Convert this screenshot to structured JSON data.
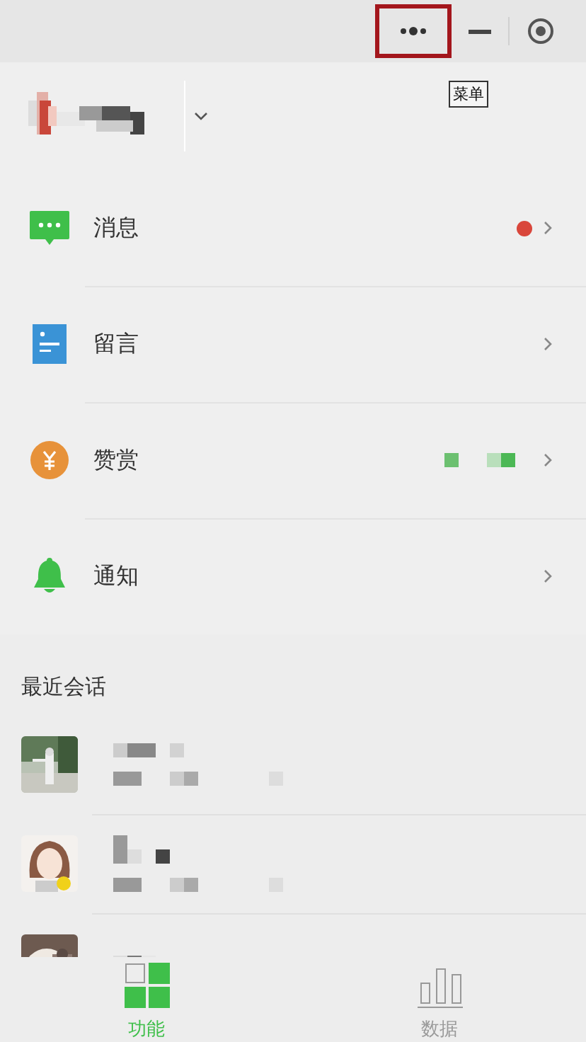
{
  "title_bar": {
    "menu_button": {
      "highlighted": true
    },
    "tooltip": "菜单"
  },
  "menu": [
    {
      "kind": "message",
      "label": "消息",
      "badge": true,
      "blurred_value": false
    },
    {
      "kind": "comment",
      "label": "留言",
      "badge": false,
      "blurred_value": false
    },
    {
      "kind": "reward",
      "label": "赞赏",
      "badge": false,
      "blurred_value": true
    },
    {
      "kind": "notice",
      "label": "通知",
      "badge": false,
      "blurred_value": false
    }
  ],
  "recent": {
    "title": "最近会话"
  },
  "tabs": [
    {
      "kind": "grid",
      "label": "功能",
      "selected": true
    },
    {
      "kind": "chart",
      "label": "数据",
      "selected": false
    }
  ]
}
